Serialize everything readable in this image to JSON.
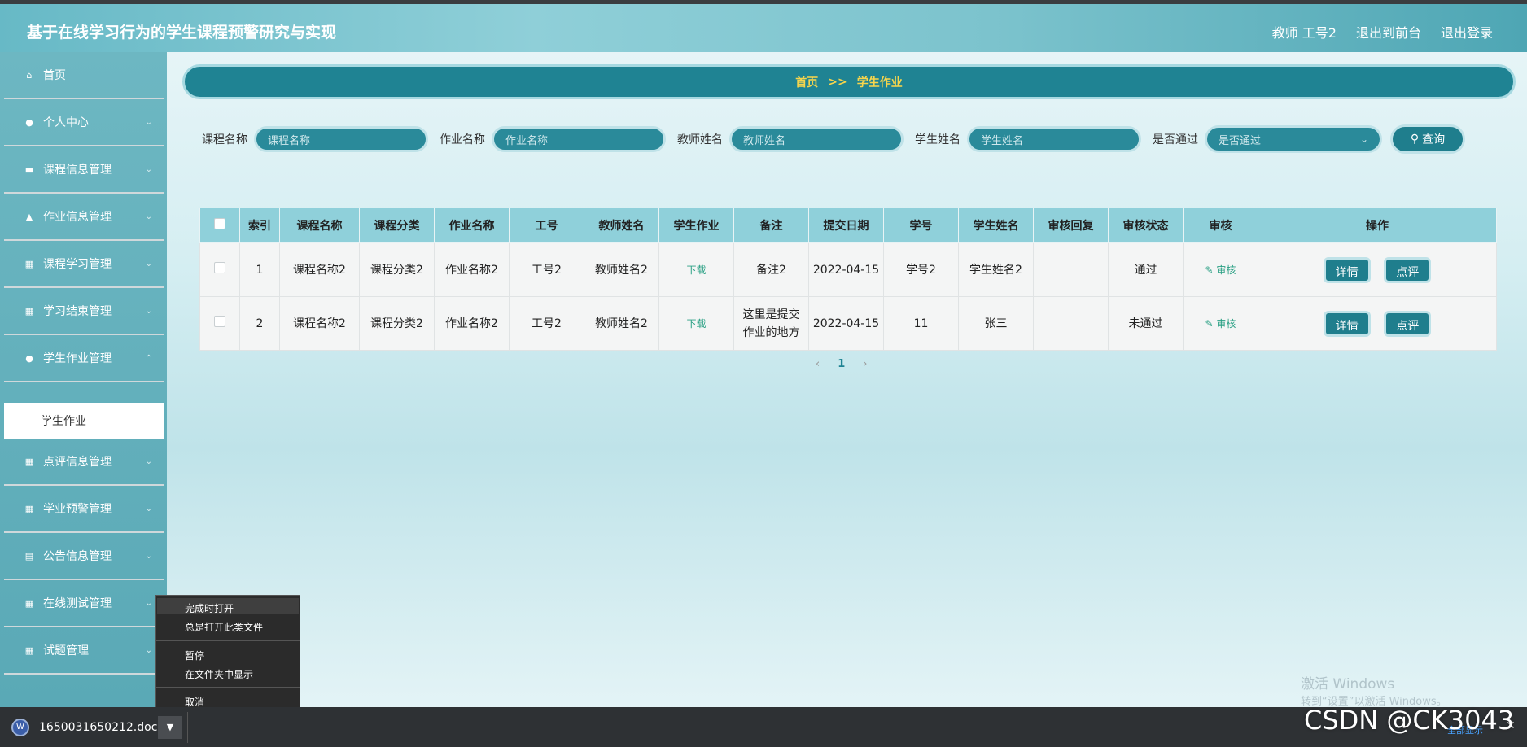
{
  "app": {
    "title": "基于在线学习行为的学生课程预警研究与实现",
    "role_label": "教师 工号2",
    "back_to_front": "退出到前台",
    "logout": "退出登录"
  },
  "sidebar": {
    "items": [
      {
        "label": "首页",
        "icon": "home-icon"
      },
      {
        "label": "个人中心",
        "icon": "user-icon"
      },
      {
        "label": "课程信息管理",
        "icon": "book-icon"
      },
      {
        "label": "作业信息管理",
        "icon": "bank-icon"
      },
      {
        "label": "课程学习管理",
        "icon": "grid-icon"
      },
      {
        "label": "学习结束管理",
        "icon": "grid-icon"
      },
      {
        "label": "学生作业管理",
        "icon": "user-icon"
      },
      {
        "label": "点评信息管理",
        "icon": "grid-icon"
      },
      {
        "label": "学业预警管理",
        "icon": "grid-icon"
      },
      {
        "label": "公告信息管理",
        "icon": "clipboard-icon"
      },
      {
        "label": "在线测试管理",
        "icon": "grid-icon"
      },
      {
        "label": "试题管理",
        "icon": "grid-icon"
      }
    ],
    "active_sub": "学生作业"
  },
  "breadcrumb": {
    "home": "首页",
    "separator": ">>",
    "current": "学生作业"
  },
  "search": {
    "course_name_label": "课程名称",
    "course_name_placeholder": "课程名称",
    "homework_name_label": "作业名称",
    "homework_name_placeholder": "作业名称",
    "teacher_name_label": "教师姓名",
    "teacher_name_placeholder": "教师姓名",
    "student_name_label": "学生姓名",
    "student_name_placeholder": "学生姓名",
    "passed_label": "是否通过",
    "passed_placeholder": "是否通过",
    "button_label": "查询"
  },
  "table": {
    "headers": [
      "索引",
      "课程名称",
      "课程分类",
      "作业名称",
      "工号",
      "教师姓名",
      "学生作业",
      "备注",
      "提交日期",
      "学号",
      "学生姓名",
      "审核回复",
      "审核状态",
      "审核",
      "操作"
    ],
    "rows": [
      {
        "index": "1",
        "course": "课程名称2",
        "category": "课程分类2",
        "homework": "作业名称2",
        "staff_no": "工号2",
        "teacher": "教师姓名2",
        "file_link": "下载",
        "remark": "备注2",
        "date": "2022-04-15",
        "student_no": "学号2",
        "student": "学生姓名2",
        "reply": "",
        "status": "通过",
        "audit": "审核",
        "detail": "详情",
        "review": "点评"
      },
      {
        "index": "2",
        "course": "课程名称2",
        "category": "课程分类2",
        "homework": "作业名称2",
        "staff_no": "工号2",
        "teacher": "教师姓名2",
        "file_link": "下载",
        "remark": "这里是提交作业的地方",
        "date": "2022-04-15",
        "student_no": "11",
        "student": "张三",
        "reply": "",
        "status": "未通过",
        "audit": "审核",
        "detail": "详情",
        "review": "点评"
      }
    ]
  },
  "pagination": {
    "prev": "‹",
    "current": "1",
    "next": "›"
  },
  "context_menu": {
    "items": [
      "完成时打开",
      "总是打开此类文件",
      "暂停",
      "在文件夹中显示",
      "取消"
    ]
  },
  "download_bar": {
    "file_name": "1650031650212.doc",
    "show_all": "全部显示",
    "close": "✕"
  },
  "overlay": {
    "activate_windows": "激活 Windows",
    "activate_hint": "转到“设置”以激活 Windows。",
    "watermark": "CSDN @CK3043"
  },
  "colors": {
    "header": "#7cc3cd",
    "breadcrumb_bg": "#1f8393",
    "breadcrumb_text": "#f6d54c",
    "table_header": "#8fd0da",
    "button": "#1f7e8d"
  }
}
